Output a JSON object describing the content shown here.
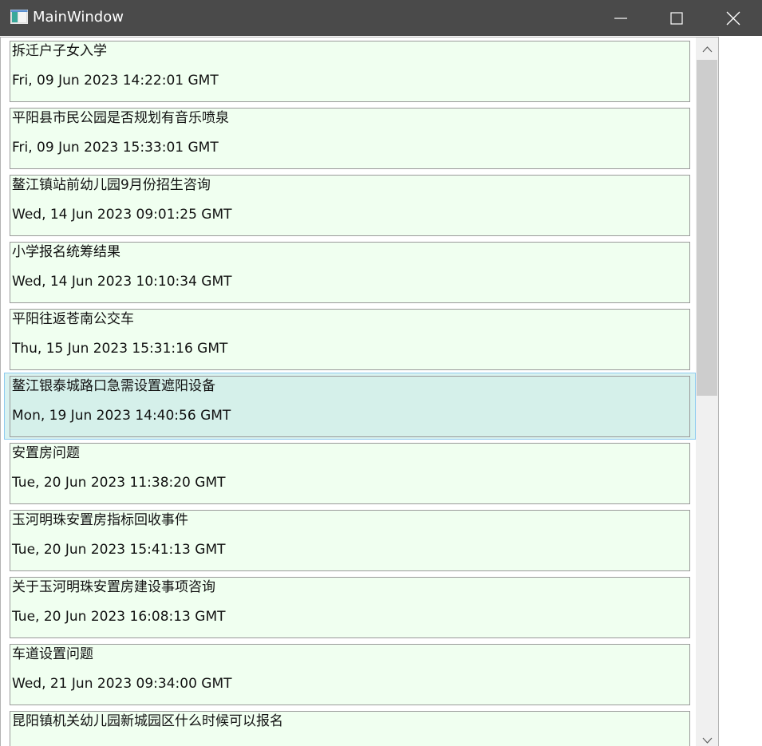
{
  "window": {
    "title": "MainWindow",
    "controls": [
      "minimize-icon",
      "maximize-icon",
      "close-icon"
    ]
  },
  "list": {
    "items": [
      {
        "title": "拆迁户子女入学",
        "date": "Fri, 09 Jun 2023 14:22:01 GMT",
        "selected": false
      },
      {
        "title": "平阳县市民公园是否规划有音乐喷泉",
        "date": "Fri, 09 Jun 2023 15:33:01 GMT",
        "selected": false
      },
      {
        "title": "鳌江镇站前幼儿园9月份招生咨询",
        "date": "Wed, 14 Jun 2023 09:01:25 GMT",
        "selected": false
      },
      {
        "title": "小学报名统筹结果",
        "date": "Wed, 14 Jun 2023 10:10:34 GMT",
        "selected": false
      },
      {
        "title": "平阳往返苍南公交车",
        "date": "Thu, 15 Jun 2023 15:31:16 GMT",
        "selected": false
      },
      {
        "title": "鳌江银泰城路口急需设置遮阳设备",
        "date": "Mon, 19 Jun 2023 14:40:56 GMT",
        "selected": true
      },
      {
        "title": "安置房问题",
        "date": "Tue, 20 Jun 2023 11:38:20 GMT",
        "selected": false
      },
      {
        "title": "玉河明珠安置房指标回收事件",
        "date": "Tue, 20 Jun 2023 15:41:13 GMT",
        "selected": false
      },
      {
        "title": "关于玉河明珠安置房建设事项咨询",
        "date": "Tue, 20 Jun 2023 16:08:13 GMT",
        "selected": false
      },
      {
        "title": "车道设置问题",
        "date": "Wed, 21 Jun 2023 09:34:00 GMT",
        "selected": false
      },
      {
        "title": "昆阳镇机关幼儿园新城园区什么时候可以报名",
        "date": "",
        "selected": false
      }
    ]
  },
  "colors": {
    "titlebar": "#4a4a4a",
    "card_background": "#f0fff0",
    "selected_background": "#d9f2ef",
    "selected_border": "#8ecbf0",
    "scroll_thumb": "#cdcdcd"
  }
}
